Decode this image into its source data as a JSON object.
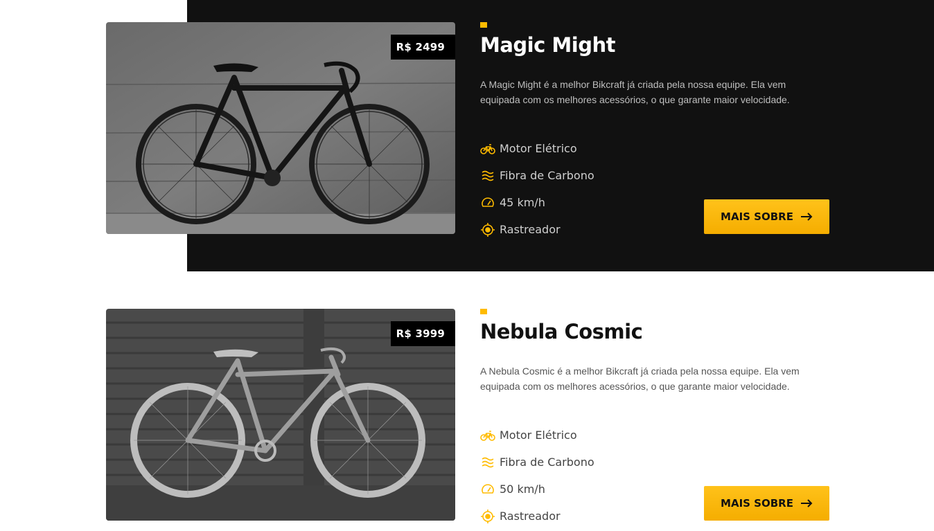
{
  "accent_color": "#ffbb00",
  "products": [
    {
      "name": "Magic Might",
      "price": "R$ 2499",
      "description": "A Magic Might é a melhor Bikcraft já criada pela nossa equipe. Ela vem equipada com os melhores acessórios, o que garante maior velocidade.",
      "features": [
        {
          "icon": "bike-icon",
          "label": "Motor Elétrico"
        },
        {
          "icon": "carbon-icon",
          "label": "Fibra de Carbono"
        },
        {
          "icon": "speedometer-icon",
          "label": "45 km/h"
        },
        {
          "icon": "tracker-icon",
          "label": "Rastreador"
        }
      ],
      "button_label": "MAIS SOBRE"
    },
    {
      "name": "Nebula Cosmic",
      "price": "R$ 3999",
      "description": "A Nebula Cosmic é a melhor Bikcraft já criada pela nossa equipe. Ela vem equipada com os melhores acessórios, o que garante maior velocidade.",
      "features": [
        {
          "icon": "bike-icon",
          "label": "Motor Elétrico"
        },
        {
          "icon": "carbon-icon",
          "label": "Fibra de Carbono"
        },
        {
          "icon": "speedometer-icon",
          "label": "50 km/h"
        },
        {
          "icon": "tracker-icon",
          "label": "Rastreador"
        }
      ],
      "button_label": "MAIS SOBRE"
    }
  ]
}
